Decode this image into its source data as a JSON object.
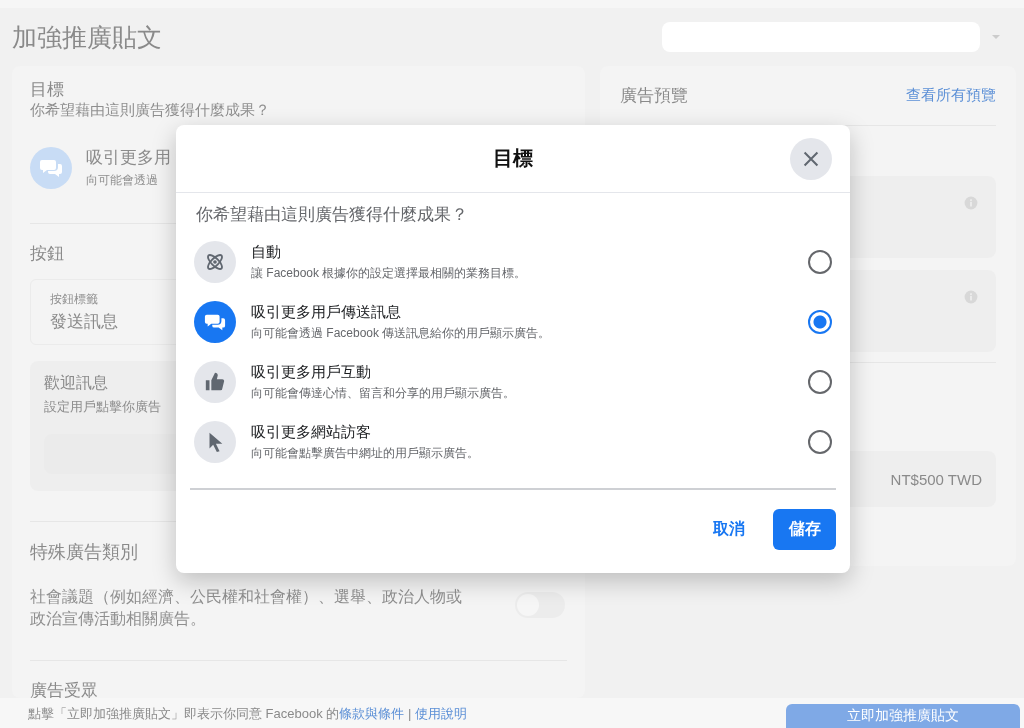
{
  "page": {
    "title": "加強推廣貼文"
  },
  "goal_section": {
    "heading": "目標",
    "question": "你希望藉由這則廣告獲得什麼成果？",
    "selected_title": "吸引更多用",
    "selected_subtitle": "向可能會透過"
  },
  "button_section": {
    "heading": "按鈕",
    "field_label": "按鈕標籤",
    "field_value": "發送訊息",
    "welcome_title": "歡迎訊息",
    "welcome_subtitle": "設定用戶點擊你廣告"
  },
  "special_ad_category": {
    "heading": "特殊廣告類別",
    "description": "社會議題（例如經濟、公民權和社會權）、選舉、政治人物或政治宣傳活動相關廣告。",
    "on": false
  },
  "audience": {
    "heading": "廣告受眾"
  },
  "preview": {
    "heading": "廣告預覽",
    "link": "查看所有預覽",
    "budget": "NT$500 TWD"
  },
  "footer": {
    "text": "點擊「立即加強推廣貼文」即表示你同意 Facebook 的",
    "links": [
      "條款與條件",
      "使用說明"
    ],
    "separator": "|",
    "button": "立即加強推廣貼文"
  },
  "dialog": {
    "title": "目標",
    "question": "你希望藉由這則廣告獲得什麼成果？",
    "options": [
      {
        "kind": "auto",
        "title": "自動",
        "description": "讓 Facebook 根據你的設定選擇最相關的業務目標。",
        "selected": false
      },
      {
        "kind": "messages",
        "title": "吸引更多用戶傳送訊息",
        "description": "向可能會透過 Facebook 傳送訊息給你的用戶顯示廣告。",
        "selected": true
      },
      {
        "kind": "engagement",
        "title": "吸引更多用戶互動",
        "description": "向可能會傳達心情、留言和分享的用戶顯示廣告。",
        "selected": false
      },
      {
        "kind": "traffic",
        "title": "吸引更多網站訪客",
        "description": "向可能會點擊廣告中網址的用戶顯示廣告。",
        "selected": false
      }
    ],
    "buttons": [
      {
        "kind": "text",
        "label": "取消"
      },
      {
        "kind": "primary",
        "label": "儲存"
      }
    ]
  }
}
